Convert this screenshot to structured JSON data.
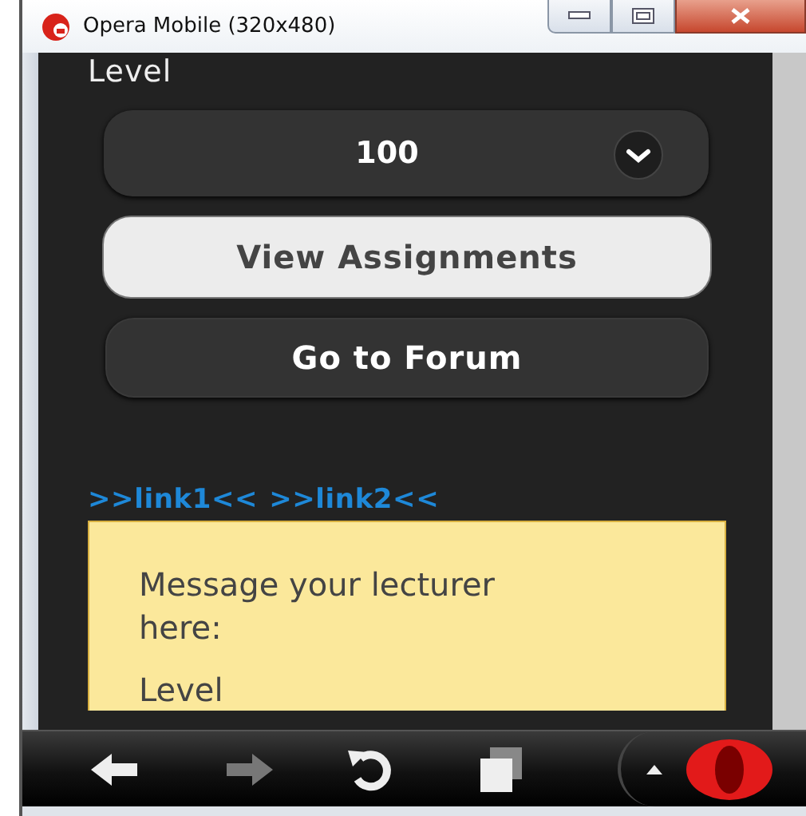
{
  "window": {
    "title": "Opera Mobile (320x480)"
  },
  "form": {
    "level_label": "Level",
    "level_select": {
      "value": "100"
    },
    "buttons": [
      {
        "label": "View Assignments",
        "kind": "light"
      },
      {
        "label": "Go to Forum",
        "kind": "dark"
      }
    ]
  },
  "links": [
    {
      "text": ">>link1<<"
    },
    {
      "text": ">>link2<<"
    }
  ],
  "message_card": {
    "heading": "Message your lecturer here:",
    "label": "Level"
  },
  "toolbar": [
    {
      "kind": "back",
      "disabled": false
    },
    {
      "kind": "forward",
      "disabled": true
    },
    {
      "kind": "reload",
      "disabled": false
    },
    {
      "kind": "tabs",
      "disabled": false
    }
  ]
}
